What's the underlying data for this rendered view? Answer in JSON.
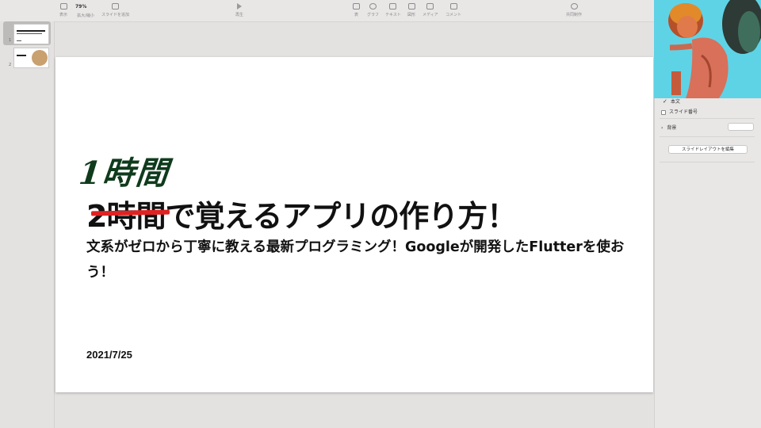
{
  "toolbar": {
    "view_label": "表示",
    "zoom_value": "79%",
    "zoom_label": "拡大/縮小",
    "add_slide_label": "スライドを追加",
    "play_label": "再生",
    "table_label": "表",
    "chart_label": "グラフ",
    "text_label": "テキスト",
    "shape_label": "図形",
    "media_label": "メディア",
    "comment_label": "コメント",
    "collaborate_label": "共同制作"
  },
  "sidebar": {
    "slides": [
      {
        "number": "1",
        "selected": true
      },
      {
        "number": "2",
        "selected": false
      }
    ]
  },
  "slide": {
    "handwritten_annotation": "1時間",
    "title": "2時間で覚えるアプリの作り方！",
    "subtitle": "文系がゼロから丁寧に教える最新プログラミング！Googleが開発したFlutterを使おう！",
    "date": "2021/7/25",
    "strike_color": "#e02222",
    "annotation_color": "#0f3b1c"
  },
  "right_panel": {
    "body_label": "本文",
    "slide_number_label": "スライド番号",
    "background_label": "背景",
    "edit_layout_button": "スライドレイアウトを編集"
  }
}
